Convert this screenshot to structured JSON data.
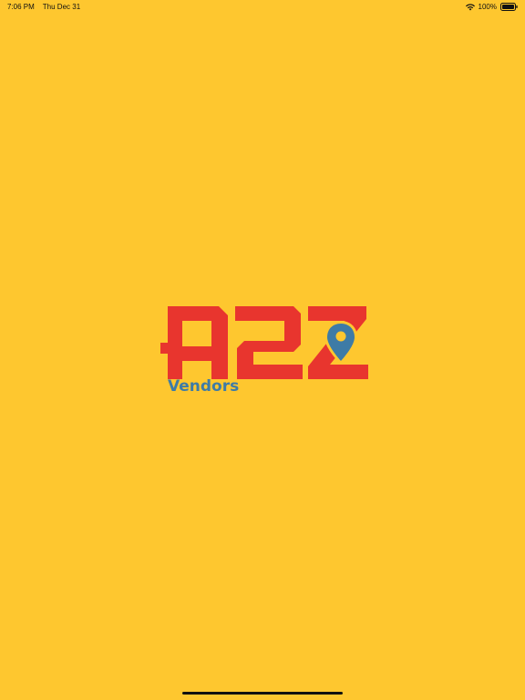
{
  "status_bar": {
    "time": "7:06 PM",
    "date": "Thu Dec 31",
    "battery": "100%",
    "icons": [
      "wifi-icon",
      "battery-icon"
    ]
  },
  "splash": {
    "logo_text": "A2Z",
    "subtitle": "Vendors",
    "background_color": "#FEC72F",
    "logo_color": "#E8352E",
    "accent_color": "#3E7BA6"
  }
}
